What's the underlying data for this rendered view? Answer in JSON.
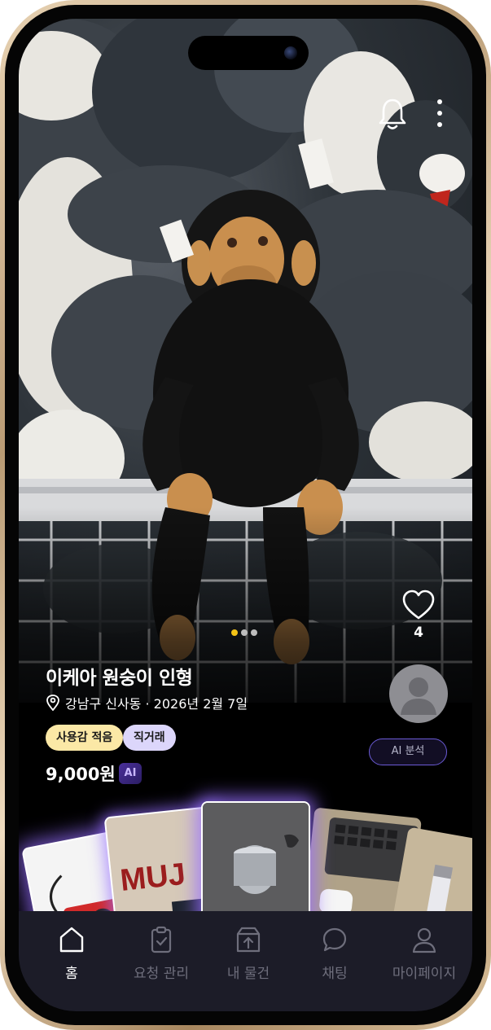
{
  "product": {
    "title": "이케아 원숭이 인형",
    "location": "강남구 신사동 · 2026년 2월 7일",
    "price": "9,000원",
    "ai_badge": "AI",
    "tags": [
      "사용감 적음",
      "직거래"
    ],
    "ai_analyze_label": "AI 분석",
    "like_count": "4"
  },
  "gallery": {
    "image_count": 3,
    "active_index": 0
  },
  "top_bar": {
    "icons": [
      "bell-icon",
      "more-vertical-icon"
    ]
  },
  "nav": {
    "items": [
      {
        "label": "홈",
        "icon": "home-icon",
        "active": true
      },
      {
        "label": "요청 관리",
        "icon": "clipboard-check-icon",
        "active": false
      },
      {
        "label": "내 물건",
        "icon": "upload-box-icon",
        "active": false
      },
      {
        "label": "채팅",
        "icon": "chat-bubble-icon",
        "active": false
      },
      {
        "label": "마이페이지",
        "icon": "person-icon",
        "active": false
      }
    ]
  },
  "colors": {
    "active_dot": "#f3c316",
    "tag_condition_bg": "#fbe8a6",
    "tag_direct_bg": "#dcd6fb",
    "ai_accent": "#6b5bd6",
    "nav_bg": "#1c1c28",
    "frame_gold": "#c9ab84"
  }
}
